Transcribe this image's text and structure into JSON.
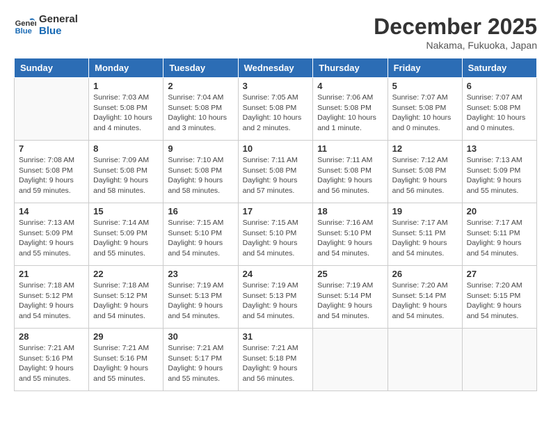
{
  "logo": {
    "line1": "General",
    "line2": "Blue"
  },
  "title": "December 2025",
  "subtitle": "Nakama, Fukuoka, Japan",
  "header": {
    "days": [
      "Sunday",
      "Monday",
      "Tuesday",
      "Wednesday",
      "Thursday",
      "Friday",
      "Saturday"
    ]
  },
  "weeks": [
    [
      {
        "day": "",
        "info": ""
      },
      {
        "day": "1",
        "info": "Sunrise: 7:03 AM\nSunset: 5:08 PM\nDaylight: 10 hours\nand 4 minutes."
      },
      {
        "day": "2",
        "info": "Sunrise: 7:04 AM\nSunset: 5:08 PM\nDaylight: 10 hours\nand 3 minutes."
      },
      {
        "day": "3",
        "info": "Sunrise: 7:05 AM\nSunset: 5:08 PM\nDaylight: 10 hours\nand 2 minutes."
      },
      {
        "day": "4",
        "info": "Sunrise: 7:06 AM\nSunset: 5:08 PM\nDaylight: 10 hours\nand 1 minute."
      },
      {
        "day": "5",
        "info": "Sunrise: 7:07 AM\nSunset: 5:08 PM\nDaylight: 10 hours\nand 0 minutes."
      },
      {
        "day": "6",
        "info": "Sunrise: 7:07 AM\nSunset: 5:08 PM\nDaylight: 10 hours\nand 0 minutes."
      }
    ],
    [
      {
        "day": "7",
        "info": "Sunrise: 7:08 AM\nSunset: 5:08 PM\nDaylight: 9 hours\nand 59 minutes."
      },
      {
        "day": "8",
        "info": "Sunrise: 7:09 AM\nSunset: 5:08 PM\nDaylight: 9 hours\nand 58 minutes."
      },
      {
        "day": "9",
        "info": "Sunrise: 7:10 AM\nSunset: 5:08 PM\nDaylight: 9 hours\nand 58 minutes."
      },
      {
        "day": "10",
        "info": "Sunrise: 7:11 AM\nSunset: 5:08 PM\nDaylight: 9 hours\nand 57 minutes."
      },
      {
        "day": "11",
        "info": "Sunrise: 7:11 AM\nSunset: 5:08 PM\nDaylight: 9 hours\nand 56 minutes."
      },
      {
        "day": "12",
        "info": "Sunrise: 7:12 AM\nSunset: 5:08 PM\nDaylight: 9 hours\nand 56 minutes."
      },
      {
        "day": "13",
        "info": "Sunrise: 7:13 AM\nSunset: 5:09 PM\nDaylight: 9 hours\nand 55 minutes."
      }
    ],
    [
      {
        "day": "14",
        "info": "Sunrise: 7:13 AM\nSunset: 5:09 PM\nDaylight: 9 hours\nand 55 minutes."
      },
      {
        "day": "15",
        "info": "Sunrise: 7:14 AM\nSunset: 5:09 PM\nDaylight: 9 hours\nand 55 minutes."
      },
      {
        "day": "16",
        "info": "Sunrise: 7:15 AM\nSunset: 5:10 PM\nDaylight: 9 hours\nand 54 minutes."
      },
      {
        "day": "17",
        "info": "Sunrise: 7:15 AM\nSunset: 5:10 PM\nDaylight: 9 hours\nand 54 minutes."
      },
      {
        "day": "18",
        "info": "Sunrise: 7:16 AM\nSunset: 5:10 PM\nDaylight: 9 hours\nand 54 minutes."
      },
      {
        "day": "19",
        "info": "Sunrise: 7:17 AM\nSunset: 5:11 PM\nDaylight: 9 hours\nand 54 minutes."
      },
      {
        "day": "20",
        "info": "Sunrise: 7:17 AM\nSunset: 5:11 PM\nDaylight: 9 hours\nand 54 minutes."
      }
    ],
    [
      {
        "day": "21",
        "info": "Sunrise: 7:18 AM\nSunset: 5:12 PM\nDaylight: 9 hours\nand 54 minutes."
      },
      {
        "day": "22",
        "info": "Sunrise: 7:18 AM\nSunset: 5:12 PM\nDaylight: 9 hours\nand 54 minutes."
      },
      {
        "day": "23",
        "info": "Sunrise: 7:19 AM\nSunset: 5:13 PM\nDaylight: 9 hours\nand 54 minutes."
      },
      {
        "day": "24",
        "info": "Sunrise: 7:19 AM\nSunset: 5:13 PM\nDaylight: 9 hours\nand 54 minutes."
      },
      {
        "day": "25",
        "info": "Sunrise: 7:19 AM\nSunset: 5:14 PM\nDaylight: 9 hours\nand 54 minutes."
      },
      {
        "day": "26",
        "info": "Sunrise: 7:20 AM\nSunset: 5:14 PM\nDaylight: 9 hours\nand 54 minutes."
      },
      {
        "day": "27",
        "info": "Sunrise: 7:20 AM\nSunset: 5:15 PM\nDaylight: 9 hours\nand 54 minutes."
      }
    ],
    [
      {
        "day": "28",
        "info": "Sunrise: 7:21 AM\nSunset: 5:16 PM\nDaylight: 9 hours\nand 55 minutes."
      },
      {
        "day": "29",
        "info": "Sunrise: 7:21 AM\nSunset: 5:16 PM\nDaylight: 9 hours\nand 55 minutes."
      },
      {
        "day": "30",
        "info": "Sunrise: 7:21 AM\nSunset: 5:17 PM\nDaylight: 9 hours\nand 55 minutes."
      },
      {
        "day": "31",
        "info": "Sunrise: 7:21 AM\nSunset: 5:18 PM\nDaylight: 9 hours\nand 56 minutes."
      },
      {
        "day": "",
        "info": ""
      },
      {
        "day": "",
        "info": ""
      },
      {
        "day": "",
        "info": ""
      }
    ]
  ]
}
